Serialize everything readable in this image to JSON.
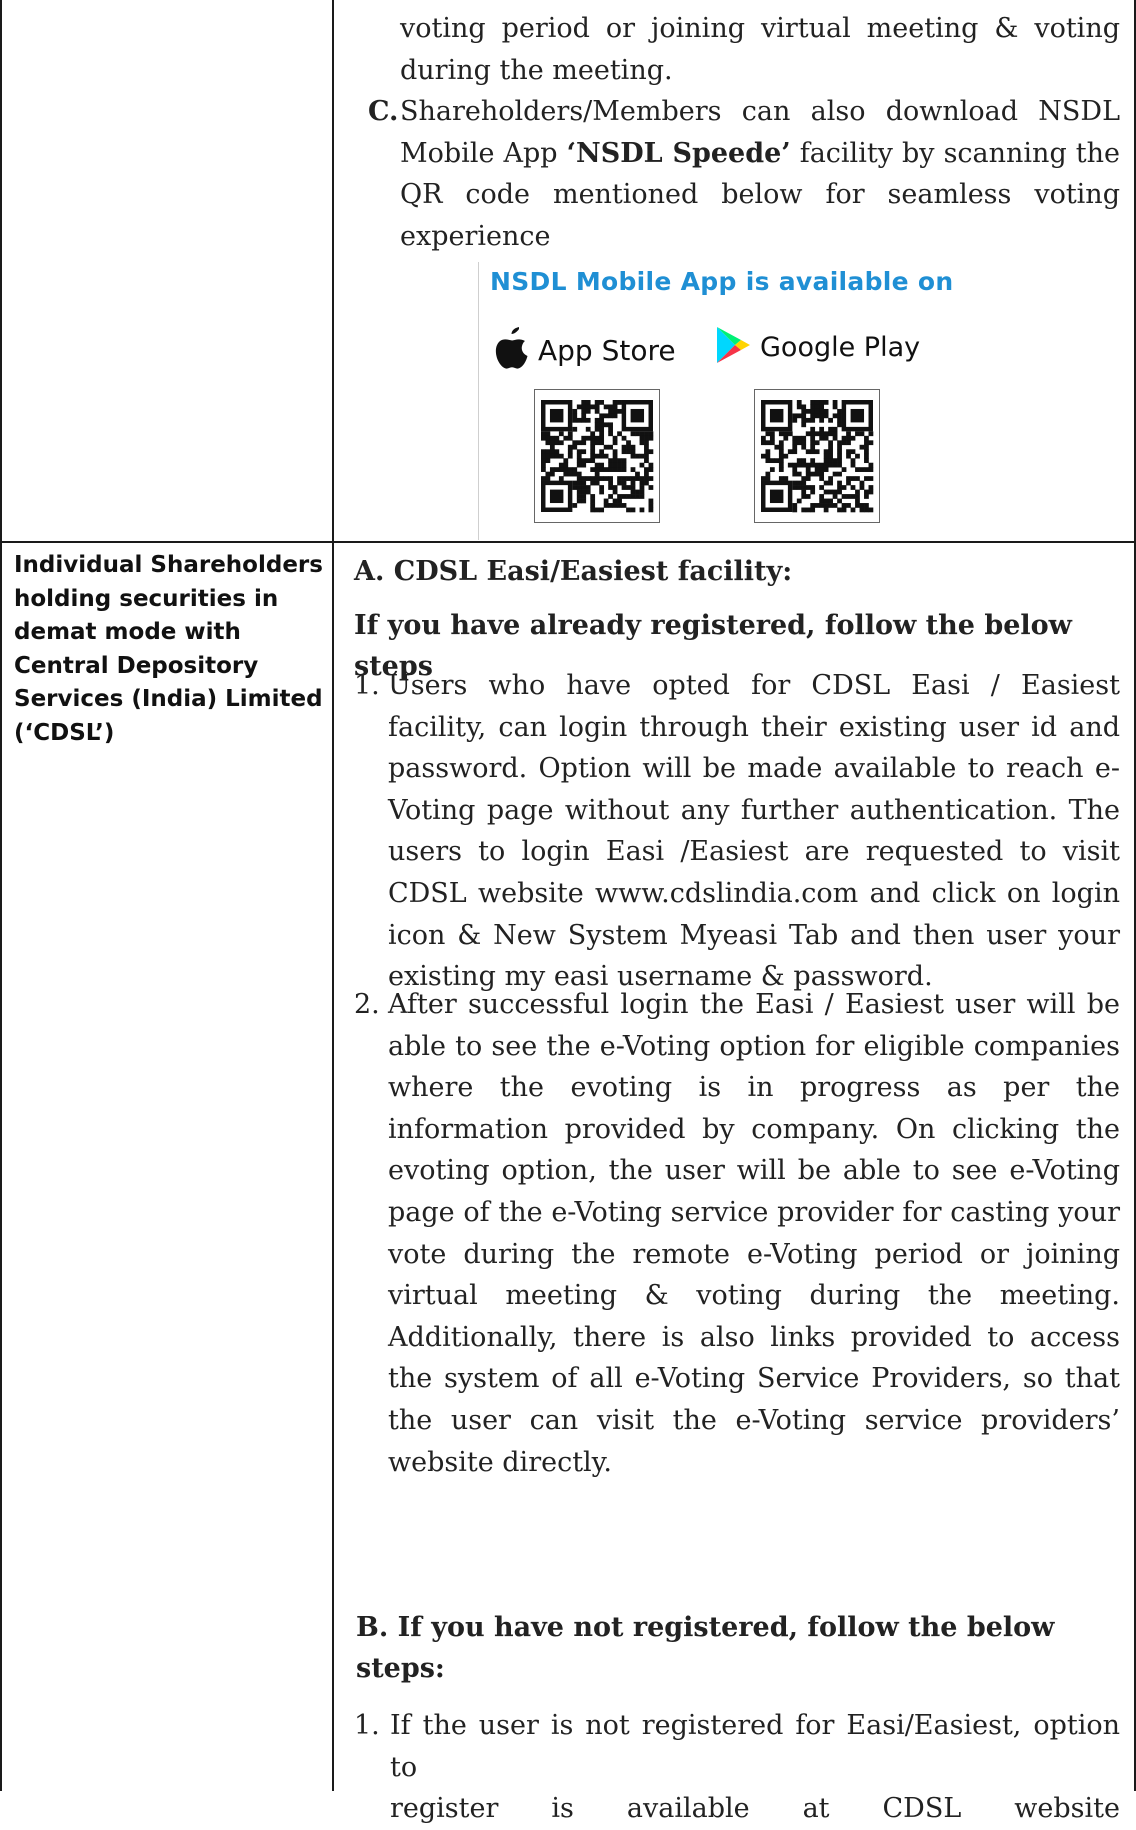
{
  "section_c": {
    "cont_line1": "voting period or joining virtual meeting & voting",
    "cont_line2": "during the meeting.",
    "marker": "C.",
    "text_before": "Shareholders/Members can also download NSDL Mobile App ",
    "bold_app": "‘NSDL Speede’",
    "text_after": " facility by scanning the QR code mentioned below for seamless voting experience"
  },
  "app_box": {
    "title": "NSDL Mobile App is available on",
    "app_store_label": "App Store",
    "google_play_label": "Google Play",
    "icons": [
      "apple-icon",
      "google-play-icon",
      "qr-code-app-store",
      "qr-code-google-play"
    ]
  },
  "cdsl_row": {
    "label": "Individual Shareholders holding securities in demat mode with Central Depository Services (India) Limited (‘CDSL’)",
    "heading_a": "A. CDSL Easi/Easiest facility:",
    "subheading": "If you have already registered, follow the below steps",
    "step1_marker": "1.",
    "step1": "Users who have opted for CDSL Easi / Easiest facility, can login through their existing user id and password. Option will be made available to reach e-Voting page without any further authentication. The users to login Easi /Easiest are requested to visit CDSL website www.cdslindia.com and click on login icon & New System Myeasi Tab and then user your existing my easi username & password.",
    "step2_marker": "2.",
    "step2": "After successful login the Easi / Easiest user will be able to see the e-Voting option for eligible companies where the evoting is in progress as per the information provided by company. On clicking the evoting option, the user will be able to see e-Voting page of the e-Voting service provider for casting your vote during the remote e-Voting period or joining virtual meeting & voting during the meeting. Additionally, there is also links provided to access the system of all e-Voting Service Providers, so that the user can visit the e-Voting service providers’ website directly.",
    "heading_b": "B. If you have not registered, follow the below steps:",
    "b_step1_marker": "1.",
    "b_step1_line1": "If the user is not registered for Easi/Easiest, option to",
    "b_step1_line2_words": [
      "register",
      "is",
      "available",
      "at",
      "CDSL",
      "website"
    ]
  }
}
